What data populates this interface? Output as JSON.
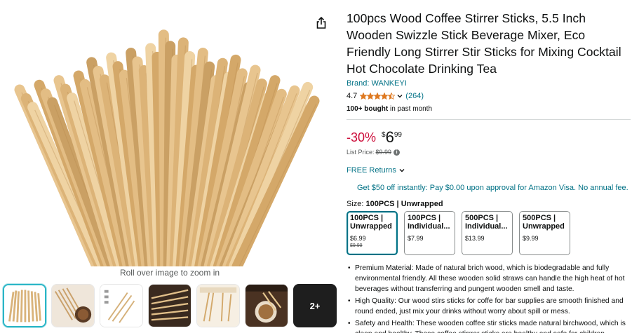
{
  "product": {
    "title": "100pcs Wood Coffee Stirrer Sticks, 5.5 Inch Wooden Swizzle Stick Beverage Mixer, Eco Friendly Long Stirrer Stir Sticks for Mixing Cocktail Hot Chocolate Drinking Tea",
    "brand": "Brand: WANKEYI",
    "rating": "4.7",
    "stars": 4.5,
    "rating_count": "(264)",
    "bought_bold": "100+ bought",
    "bought_rest": " in past month"
  },
  "price": {
    "discount": "-30%",
    "symbol": "$",
    "whole": "6",
    "fraction": "99",
    "list_label": "List Price:",
    "list_value": "$9.99",
    "info_icon": "info-icon"
  },
  "returns": {
    "label": "FREE Returns"
  },
  "promo": {
    "text": "Get $50 off instantly: Pay $0.00 upon approval for Amazon Visa. No annual fee."
  },
  "size": {
    "label": "Size:",
    "selected": "100PCS | Unwrapped",
    "options": [
      {
        "name_l1": "100PCS |",
        "name_l2": "Unwrapped",
        "price": "$6.99",
        "was": "$9.99",
        "selected": true
      },
      {
        "name_l1": "100PCS |",
        "name_l2": "Individual...",
        "price": "$7.99",
        "was": "",
        "selected": false
      },
      {
        "name_l1": "500PCS |",
        "name_l2": "Individual...",
        "price": "$13.99",
        "was": "",
        "selected": false
      },
      {
        "name_l1": "500PCS |",
        "name_l2": "Unwrapped",
        "price": "$9.99",
        "was": "",
        "selected": false
      }
    ]
  },
  "bullets": [
    "Premium Material: Made of natural brich wood, which is biodegradable and fully environmental friendly. All these wooden solid straws can handle the high heat of hot beverages without transferring and pungent wooden smell and taste.",
    "High Quality: Our wood stirs sticks for coffe for bar supplies are smooth finished and round ended, just mix your drinks without worry about spill or mess.",
    "Safety and Health: These wooden coffee stir sticks made natural birchwood, which is clean and healthy. These coffee stirrrer sticks are healthy and safe for children,"
  ],
  "gallery": {
    "zoom_hint": "Roll over image to zoom in",
    "more_label": "2+",
    "share_icon": "share-icon"
  },
  "colors": {
    "link": "#007185",
    "discount": "#cc0c39",
    "star": "#de7921",
    "selected_thumb": "#2bb6c7"
  }
}
